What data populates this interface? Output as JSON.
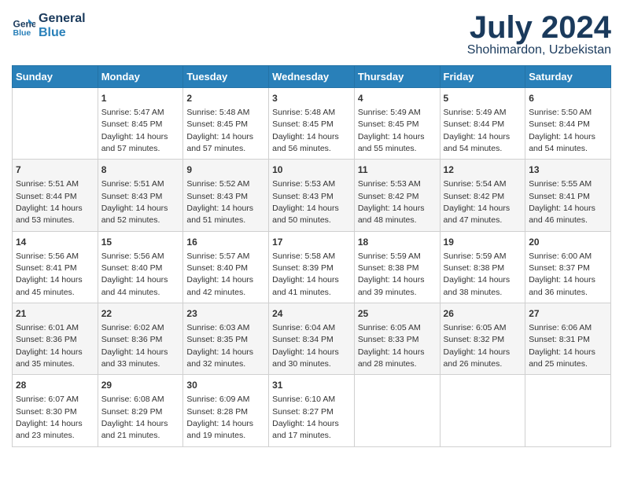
{
  "logo": {
    "line1": "General",
    "line2": "Blue"
  },
  "title": "July 2024",
  "subtitle": "Shohimardon, Uzbekistan",
  "days_of_week": [
    "Sunday",
    "Monday",
    "Tuesday",
    "Wednesday",
    "Thursday",
    "Friday",
    "Saturday"
  ],
  "weeks": [
    [
      {
        "day": "",
        "info": ""
      },
      {
        "day": "1",
        "info": "Sunrise: 5:47 AM\nSunset: 8:45 PM\nDaylight: 14 hours\nand 57 minutes."
      },
      {
        "day": "2",
        "info": "Sunrise: 5:48 AM\nSunset: 8:45 PM\nDaylight: 14 hours\nand 57 minutes."
      },
      {
        "day": "3",
        "info": "Sunrise: 5:48 AM\nSunset: 8:45 PM\nDaylight: 14 hours\nand 56 minutes."
      },
      {
        "day": "4",
        "info": "Sunrise: 5:49 AM\nSunset: 8:45 PM\nDaylight: 14 hours\nand 55 minutes."
      },
      {
        "day": "5",
        "info": "Sunrise: 5:49 AM\nSunset: 8:44 PM\nDaylight: 14 hours\nand 54 minutes."
      },
      {
        "day": "6",
        "info": "Sunrise: 5:50 AM\nSunset: 8:44 PM\nDaylight: 14 hours\nand 54 minutes."
      }
    ],
    [
      {
        "day": "7",
        "info": "Sunrise: 5:51 AM\nSunset: 8:44 PM\nDaylight: 14 hours\nand 53 minutes."
      },
      {
        "day": "8",
        "info": "Sunrise: 5:51 AM\nSunset: 8:43 PM\nDaylight: 14 hours\nand 52 minutes."
      },
      {
        "day": "9",
        "info": "Sunrise: 5:52 AM\nSunset: 8:43 PM\nDaylight: 14 hours\nand 51 minutes."
      },
      {
        "day": "10",
        "info": "Sunrise: 5:53 AM\nSunset: 8:43 PM\nDaylight: 14 hours\nand 50 minutes."
      },
      {
        "day": "11",
        "info": "Sunrise: 5:53 AM\nSunset: 8:42 PM\nDaylight: 14 hours\nand 48 minutes."
      },
      {
        "day": "12",
        "info": "Sunrise: 5:54 AM\nSunset: 8:42 PM\nDaylight: 14 hours\nand 47 minutes."
      },
      {
        "day": "13",
        "info": "Sunrise: 5:55 AM\nSunset: 8:41 PM\nDaylight: 14 hours\nand 46 minutes."
      }
    ],
    [
      {
        "day": "14",
        "info": "Sunrise: 5:56 AM\nSunset: 8:41 PM\nDaylight: 14 hours\nand 45 minutes."
      },
      {
        "day": "15",
        "info": "Sunrise: 5:56 AM\nSunset: 8:40 PM\nDaylight: 14 hours\nand 44 minutes."
      },
      {
        "day": "16",
        "info": "Sunrise: 5:57 AM\nSunset: 8:40 PM\nDaylight: 14 hours\nand 42 minutes."
      },
      {
        "day": "17",
        "info": "Sunrise: 5:58 AM\nSunset: 8:39 PM\nDaylight: 14 hours\nand 41 minutes."
      },
      {
        "day": "18",
        "info": "Sunrise: 5:59 AM\nSunset: 8:38 PM\nDaylight: 14 hours\nand 39 minutes."
      },
      {
        "day": "19",
        "info": "Sunrise: 5:59 AM\nSunset: 8:38 PM\nDaylight: 14 hours\nand 38 minutes."
      },
      {
        "day": "20",
        "info": "Sunrise: 6:00 AM\nSunset: 8:37 PM\nDaylight: 14 hours\nand 36 minutes."
      }
    ],
    [
      {
        "day": "21",
        "info": "Sunrise: 6:01 AM\nSunset: 8:36 PM\nDaylight: 14 hours\nand 35 minutes."
      },
      {
        "day": "22",
        "info": "Sunrise: 6:02 AM\nSunset: 8:36 PM\nDaylight: 14 hours\nand 33 minutes."
      },
      {
        "day": "23",
        "info": "Sunrise: 6:03 AM\nSunset: 8:35 PM\nDaylight: 14 hours\nand 32 minutes."
      },
      {
        "day": "24",
        "info": "Sunrise: 6:04 AM\nSunset: 8:34 PM\nDaylight: 14 hours\nand 30 minutes."
      },
      {
        "day": "25",
        "info": "Sunrise: 6:05 AM\nSunset: 8:33 PM\nDaylight: 14 hours\nand 28 minutes."
      },
      {
        "day": "26",
        "info": "Sunrise: 6:05 AM\nSunset: 8:32 PM\nDaylight: 14 hours\nand 26 minutes."
      },
      {
        "day": "27",
        "info": "Sunrise: 6:06 AM\nSunset: 8:31 PM\nDaylight: 14 hours\nand 25 minutes."
      }
    ],
    [
      {
        "day": "28",
        "info": "Sunrise: 6:07 AM\nSunset: 8:30 PM\nDaylight: 14 hours\nand 23 minutes."
      },
      {
        "day": "29",
        "info": "Sunrise: 6:08 AM\nSunset: 8:29 PM\nDaylight: 14 hours\nand 21 minutes."
      },
      {
        "day": "30",
        "info": "Sunrise: 6:09 AM\nSunset: 8:28 PM\nDaylight: 14 hours\nand 19 minutes."
      },
      {
        "day": "31",
        "info": "Sunrise: 6:10 AM\nSunset: 8:27 PM\nDaylight: 14 hours\nand 17 minutes."
      },
      {
        "day": "",
        "info": ""
      },
      {
        "day": "",
        "info": ""
      },
      {
        "day": "",
        "info": ""
      }
    ]
  ]
}
